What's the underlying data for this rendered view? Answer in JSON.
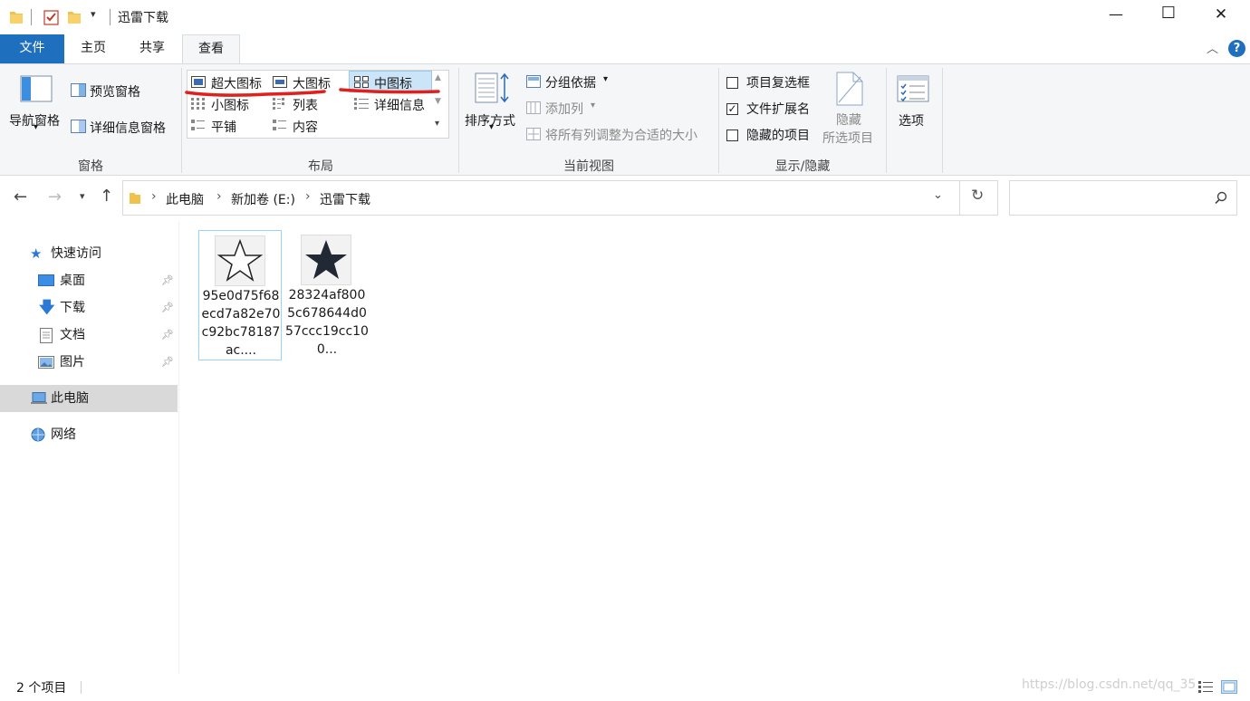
{
  "window": {
    "title": "迅雷下载",
    "minimize": "—",
    "maximize": "☐",
    "close": "✕"
  },
  "tabs": [
    {
      "label": "文件"
    },
    {
      "label": "主页"
    },
    {
      "label": "共享"
    },
    {
      "label": "查看"
    }
  ],
  "ribbon": {
    "panes": {
      "nav_pane": "导航窗格",
      "preview_pane": "预览窗格",
      "details_pane": "详细信息窗格",
      "group": "窗格"
    },
    "layout": {
      "extra_large": "超大图标",
      "large": "大图标",
      "medium": "中图标",
      "small": "小图标",
      "list": "列表",
      "details": "详细信息",
      "tiles": "平铺",
      "content": "内容",
      "group": "布局"
    },
    "current_view": {
      "sort_by": "排序方式",
      "group_by": "分组依据",
      "add_columns": "添加列",
      "size_all_columns": "将所有列调整为合适的大小",
      "group": "当前视图"
    },
    "show_hide": {
      "item_checkboxes": "项目复选框",
      "item_checkboxes_checked": false,
      "file_extensions": "文件扩展名",
      "file_extensions_checked": true,
      "hidden_items": "隐藏的项目",
      "hidden_items_checked": false,
      "hide_selected_line1": "隐藏",
      "hide_selected_line2": "所选项目",
      "group": "显示/隐藏"
    },
    "options": "选项"
  },
  "address": {
    "breadcrumb": [
      "此电脑",
      "新加卷 (E:)",
      "迅雷下载"
    ],
    "search_placeholder": ""
  },
  "nav": {
    "quick_access": "快速访问",
    "items": [
      {
        "label": "桌面"
      },
      {
        "label": "下载"
      },
      {
        "label": "文档"
      },
      {
        "label": "图片"
      }
    ],
    "this_pc": "此电脑",
    "network": "网络"
  },
  "files": [
    {
      "name": "95e0d75f68ecd7a82e70c92bc78187ac....",
      "icon": "star-outline-icon"
    },
    {
      "name": "28324af8005c678644d057ccc19cc100...",
      "icon": "star-filled-icon"
    }
  ],
  "status": {
    "count": "2 个项目"
  },
  "watermark": "https://blog.csdn.net/qq_35"
}
